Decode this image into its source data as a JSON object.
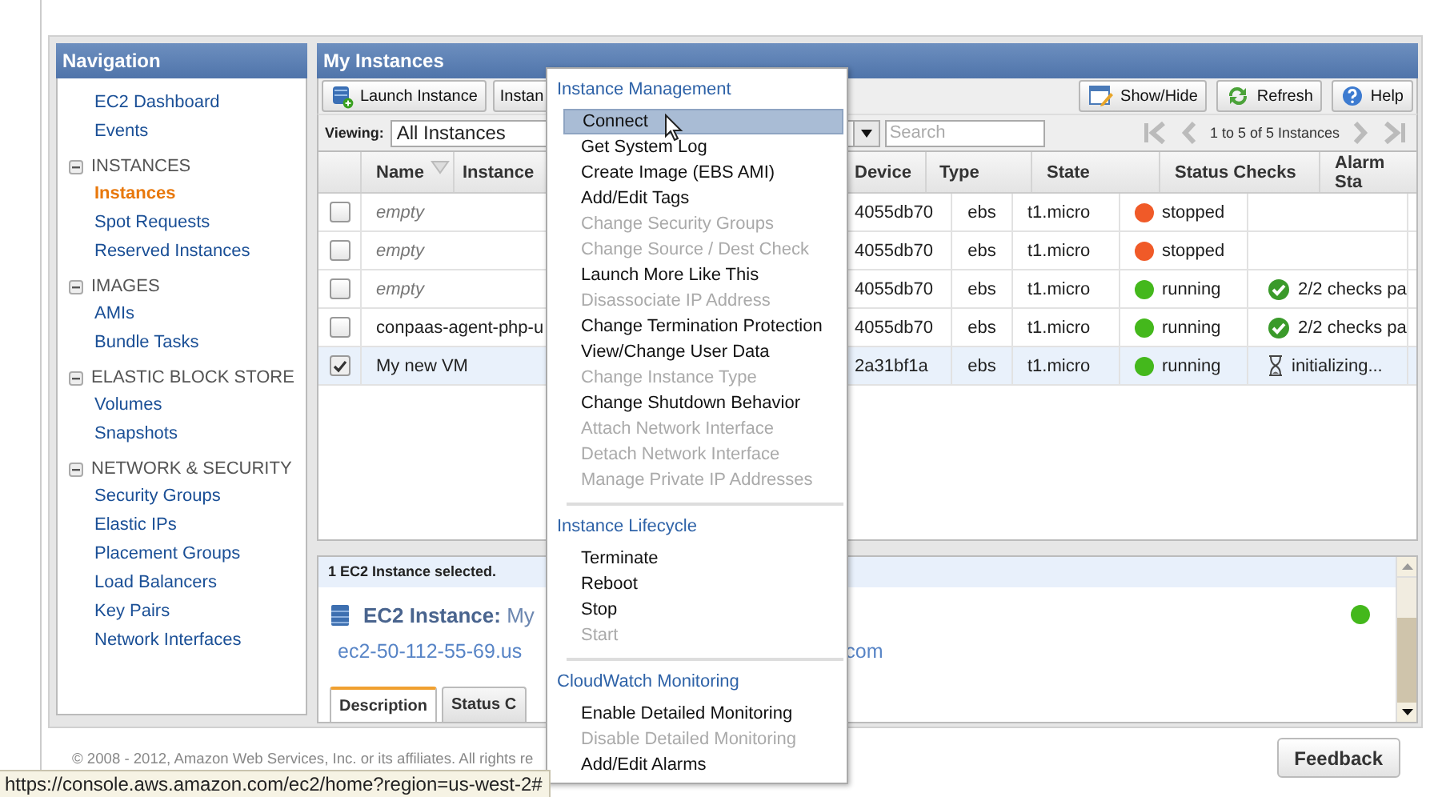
{
  "navigation": {
    "title": "Navigation",
    "groups": [
      {
        "items": [
          {
            "label": "EC2 Dashboard",
            "selected": false
          },
          {
            "label": "Events",
            "selected": false
          }
        ]
      },
      {
        "heading": "INSTANCES",
        "expanded": true,
        "items": [
          {
            "label": "Instances",
            "selected": true
          },
          {
            "label": "Spot Requests",
            "selected": false
          },
          {
            "label": "Reserved Instances",
            "selected": false
          }
        ]
      },
      {
        "heading": "IMAGES",
        "expanded": true,
        "items": [
          {
            "label": "AMIs",
            "selected": false
          },
          {
            "label": "Bundle Tasks",
            "selected": false
          }
        ]
      },
      {
        "heading": "ELASTIC BLOCK STORE",
        "expanded": true,
        "items": [
          {
            "label": "Volumes",
            "selected": false
          },
          {
            "label": "Snapshots",
            "selected": false
          }
        ]
      },
      {
        "heading": "NETWORK & SECURITY",
        "expanded": true,
        "items": [
          {
            "label": "Security Groups",
            "selected": false
          },
          {
            "label": "Elastic IPs",
            "selected": false
          },
          {
            "label": "Placement Groups",
            "selected": false
          },
          {
            "label": "Load Balancers",
            "selected": false
          },
          {
            "label": "Key Pairs",
            "selected": false
          },
          {
            "label": "Network Interfaces",
            "selected": false
          }
        ]
      }
    ]
  },
  "instances": {
    "title": "My Instances",
    "toolbar": {
      "left_buttons": [
        {
          "label": "Launch Instance",
          "kind": "launch"
        },
        {
          "label": "Instan",
          "kind": "plain"
        }
      ],
      "right_buttons": [
        {
          "label": "Show/Hide",
          "kind": "showhide"
        },
        {
          "label": "Refresh",
          "kind": "refresh"
        },
        {
          "label": "Help",
          "kind": "help"
        }
      ]
    },
    "viewing": {
      "label": "Viewing:",
      "value": "All Instances"
    },
    "search": {
      "placeholder": "Search"
    },
    "pagination": "1 to 5 of 5 Instances",
    "table": {
      "columns": [
        "Name",
        "Instance",
        "Device",
        "Type",
        "State",
        "Status Checks",
        "Alarm Sta"
      ],
      "rows": [
        {
          "checked": false,
          "selected": false,
          "name": "empty",
          "unnamed": true,
          "device": "4055db70",
          "root": "ebs",
          "type": "t1.micro",
          "state": {
            "label": "stopped",
            "color": "#f05a28"
          }
        },
        {
          "checked": false,
          "selected": false,
          "name": "empty",
          "unnamed": true,
          "device": "4055db70",
          "root": "ebs",
          "type": "t1.micro",
          "state": {
            "label": "stopped",
            "color": "#f05a28"
          }
        },
        {
          "checked": false,
          "selected": false,
          "name": "empty",
          "unnamed": true,
          "device": "4055db70",
          "root": "ebs",
          "type": "t1.micro",
          "state": {
            "label": "running",
            "color": "#44b81c"
          },
          "status": {
            "kind": "passed",
            "label": "2/2 checks pa"
          }
        },
        {
          "checked": false,
          "selected": false,
          "name": "conpaas-agent-php-u",
          "unnamed": false,
          "device": "4055db70",
          "root": "ebs",
          "type": "t1.micro",
          "state": {
            "label": "running",
            "color": "#44b81c"
          },
          "status": {
            "kind": "passed",
            "label": "2/2 checks pa"
          }
        },
        {
          "checked": true,
          "selected": true,
          "name": "My new VM",
          "unnamed": false,
          "device": "2a31bf1a",
          "root": "ebs",
          "type": "t1.micro",
          "state": {
            "label": "running",
            "color": "#44b81c"
          },
          "status": {
            "kind": "initializing",
            "label": "initializing..."
          }
        }
      ]
    }
  },
  "details": {
    "summary": "1 EC2 Instance selected.",
    "title": "**EC2 Instance:** My",
    "host_start": "ec2-50-112-55-69.us",
    "host_end": "com",
    "tabs": [
      {
        "label": "Description",
        "selected": true
      },
      {
        "label": "Status C",
        "selected": false
      }
    ]
  },
  "context_menu": {
    "groups": [
      {
        "heading": "Instance Management",
        "items": [
          {
            "label": "Connect",
            "disabled": false,
            "selected": true
          },
          {
            "label": "Get System Log",
            "disabled": false,
            "selected": false
          },
          {
            "label": "Create Image (EBS AMI)",
            "disabled": false,
            "selected": false
          },
          {
            "label": "Add/Edit Tags",
            "disabled": false,
            "selected": false
          },
          {
            "label": "Change Security Groups",
            "disabled": true,
            "selected": false
          },
          {
            "label": "Change Source / Dest Check",
            "disabled": true,
            "selected": false
          },
          {
            "label": "Launch More Like This",
            "disabled": false,
            "selected": false
          },
          {
            "label": "Disassociate IP Address",
            "disabled": true,
            "selected": false
          },
          {
            "label": "Change Termination Protection",
            "disabled": false,
            "selected": false
          },
          {
            "label": "View/Change User Data",
            "disabled": false,
            "selected": false
          },
          {
            "label": "Change Instance Type",
            "disabled": true,
            "selected": false
          },
          {
            "label": "Change Shutdown Behavior",
            "disabled": false,
            "selected": false
          },
          {
            "label": "Attach Network Interface",
            "disabled": true,
            "selected": false
          },
          {
            "label": "Detach Network Interface",
            "disabled": true,
            "selected": false
          },
          {
            "label": "Manage Private IP Addresses",
            "disabled": true,
            "selected": false
          }
        ]
      },
      {
        "heading": "Instance Lifecycle",
        "items": [
          {
            "label": "Terminate",
            "disabled": false,
            "selected": false
          },
          {
            "label": "Reboot",
            "disabled": false,
            "selected": false
          },
          {
            "label": "Stop",
            "disabled": false,
            "selected": false
          },
          {
            "label": "Start",
            "disabled": true,
            "selected": false
          }
        ]
      },
      {
        "heading": "CloudWatch Monitoring",
        "items": [
          {
            "label": "Enable Detailed Monitoring",
            "disabled": false,
            "selected": false
          },
          {
            "label": "Disable Detailed Monitoring",
            "disabled": true,
            "selected": false
          },
          {
            "label": "Add/Edit Alarms",
            "disabled": false,
            "selected": false
          }
        ]
      }
    ]
  },
  "footer": {
    "copyright": "© 2008 - 2012, Amazon Web Services, Inc. or its affiliates. All rights re",
    "feedback": "Feedback"
  },
  "status_url": "https://console.aws.amazon.com/ec2/home?region=us-west-2#"
}
